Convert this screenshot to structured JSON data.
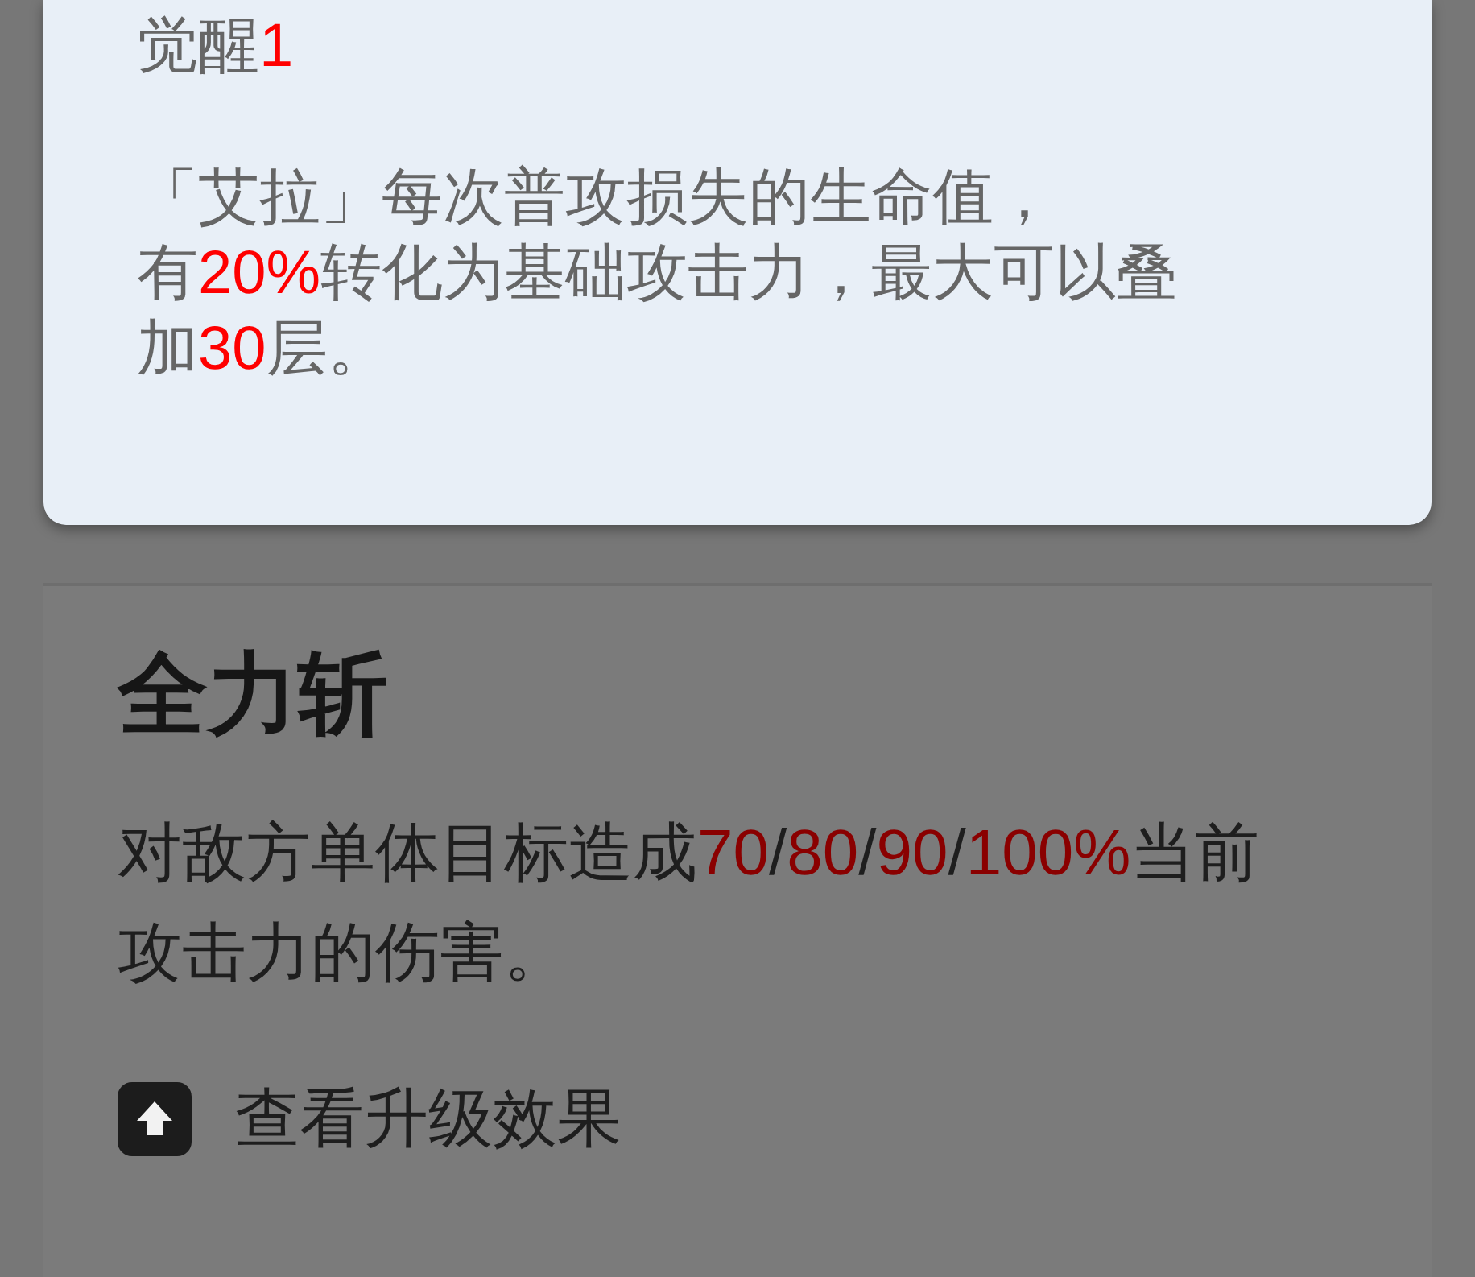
{
  "awakening_popup": {
    "title": [
      {
        "text": "觉醒",
        "highlight": false
      },
      {
        "text": "1",
        "highlight": true
      }
    ],
    "description": [
      [
        {
          "text": "「艾拉」每次普攻损失的生命值，",
          "highlight": false
        }
      ],
      [
        {
          "text": "有",
          "highlight": false
        },
        {
          "text": "20%",
          "highlight": true
        },
        {
          "text": "转化为基础攻击力，最大可以叠加",
          "highlight": false
        },
        {
          "text": "30",
          "highlight": true
        },
        {
          "text": "层。",
          "highlight": false
        }
      ]
    ]
  },
  "skill": {
    "name": "全力斩",
    "description": [
      {
        "text": "对敌方单体目标造成",
        "highlight": false
      },
      {
        "text": "70",
        "highlight": true
      },
      {
        "text": "/",
        "highlight": false
      },
      {
        "text": "80",
        "highlight": true
      },
      {
        "text": "/",
        "highlight": false
      },
      {
        "text": "90",
        "highlight": true
      },
      {
        "text": "/",
        "highlight": false
      },
      {
        "text": "100%",
        "highlight": true
      },
      {
        "text": "当前攻击力的伤害。",
        "highlight": false
      }
    ],
    "upgrade_link": "查看升级效果"
  }
}
